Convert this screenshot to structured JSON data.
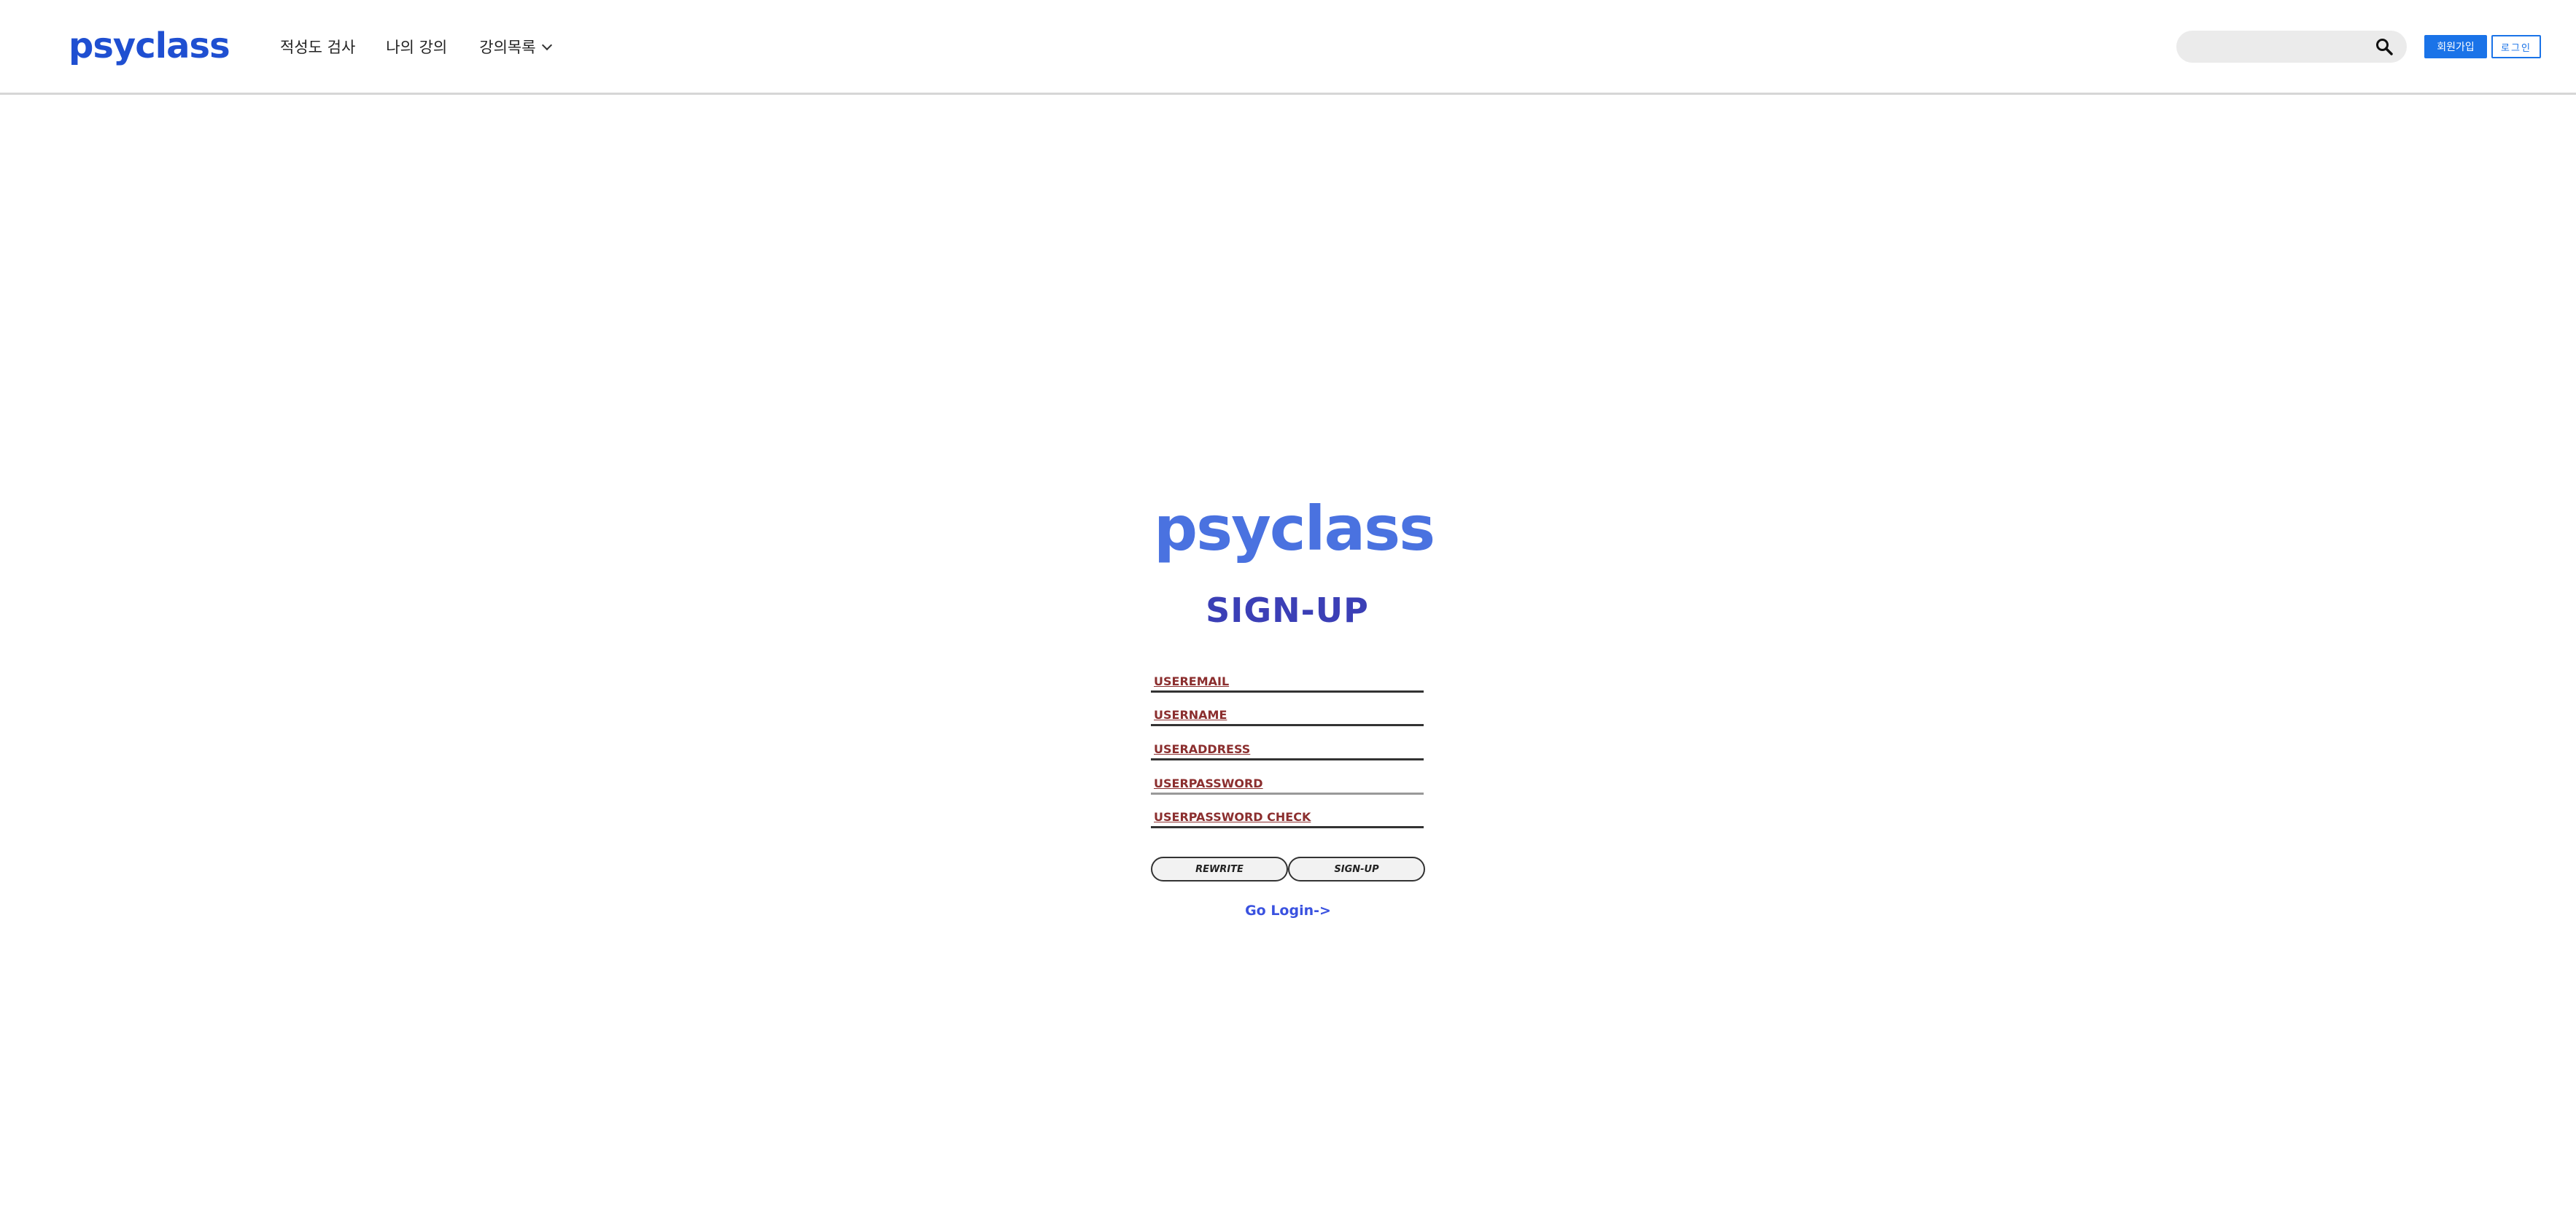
{
  "header": {
    "brand": "psyclass",
    "nav": [
      {
        "label": "적성도 검사"
      },
      {
        "label": "나의 강의"
      },
      {
        "label": "강의목록"
      }
    ],
    "search": {
      "placeholder": "",
      "icon": "search-icon"
    },
    "join_label": "회원가입",
    "login_label": "로그인"
  },
  "signup": {
    "logo": "psyclass",
    "title": "SIGN-UP",
    "fields": [
      {
        "placeholder": "USEREMAIL"
      },
      {
        "placeholder": "USERNAME"
      },
      {
        "placeholder": "USERADDRESS"
      },
      {
        "placeholder": "USERPASSWORD"
      },
      {
        "placeholder": "USERPASSWORD CHECK"
      }
    ],
    "rewrite_label": "REWRITE",
    "signup_label": "SIGN-UP",
    "go_login": "Go Login->"
  },
  "colors": {
    "brand": "#1f4fd1",
    "title": "#3b3fb6",
    "field_label": "#8b2e2e",
    "primary_button": "#1a73e8",
    "link": "#3a52e0"
  }
}
